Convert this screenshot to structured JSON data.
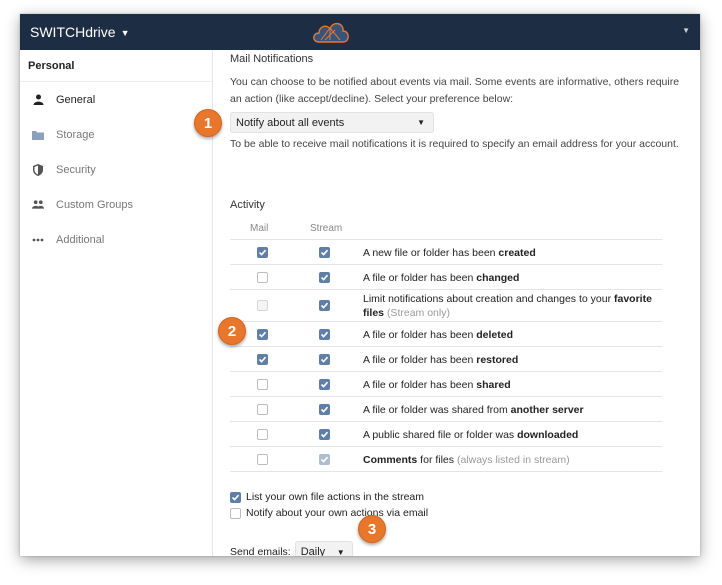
{
  "app": {
    "title": "SWITCHdrive"
  },
  "sidebar": {
    "heading": "Personal",
    "items": [
      {
        "label": "General",
        "icon": "user-icon",
        "active": true
      },
      {
        "label": "Storage",
        "icon": "folder-icon",
        "active": false
      },
      {
        "label": "Security",
        "icon": "shield-icon",
        "active": false
      },
      {
        "label": "Custom Groups",
        "icon": "group-icon",
        "active": false
      },
      {
        "label": "Additional",
        "icon": "more-icon",
        "active": false
      }
    ]
  },
  "mail": {
    "title": "Mail Notifications",
    "description": "You can choose to be notified about events via mail. Some events are informative, others require an action (like accept/decline). Select your preference below:",
    "select_value": "Notify about all events",
    "note": "To be able to receive mail notifications it is required to specify an email address for your account."
  },
  "activity": {
    "label": "Activity",
    "col_mail": "Mail",
    "col_stream": "Stream",
    "rows": [
      {
        "pre": "A new file or folder has been ",
        "bold": "created",
        "post": "",
        "muted": ""
      },
      {
        "pre": "A file or folder has been ",
        "bold": "changed",
        "post": "",
        "muted": ""
      },
      {
        "pre": "Limit notifications about creation and changes to your ",
        "bold": "favorite files",
        "post": " ",
        "muted": "(Stream only)"
      },
      {
        "pre": "A file or folder has been ",
        "bold": "deleted",
        "post": "",
        "muted": ""
      },
      {
        "pre": "A file or folder has been ",
        "bold": "restored",
        "post": "",
        "muted": ""
      },
      {
        "pre": "A file or folder has been ",
        "bold": "shared",
        "post": "",
        "muted": ""
      },
      {
        "pre": "A file or folder was shared from ",
        "bold": "another server",
        "post": "",
        "muted": ""
      },
      {
        "pre": "A public shared file or folder was ",
        "bold": "downloaded",
        "post": "",
        "muted": ""
      },
      {
        "pre": "",
        "bold": "Comments",
        "post": " for files ",
        "muted": "(always listed in stream)"
      }
    ]
  },
  "options": {
    "list_own": "List your own file actions in the stream",
    "notify_own": "Notify about your own actions via email"
  },
  "send": {
    "label": "Send emails:",
    "value": "Daily"
  },
  "badges": [
    "1",
    "2",
    "3"
  ],
  "colors": {
    "topbar": "#1d2d44",
    "checkbox": "#5f7fa6",
    "badge": "#e8772e"
  }
}
